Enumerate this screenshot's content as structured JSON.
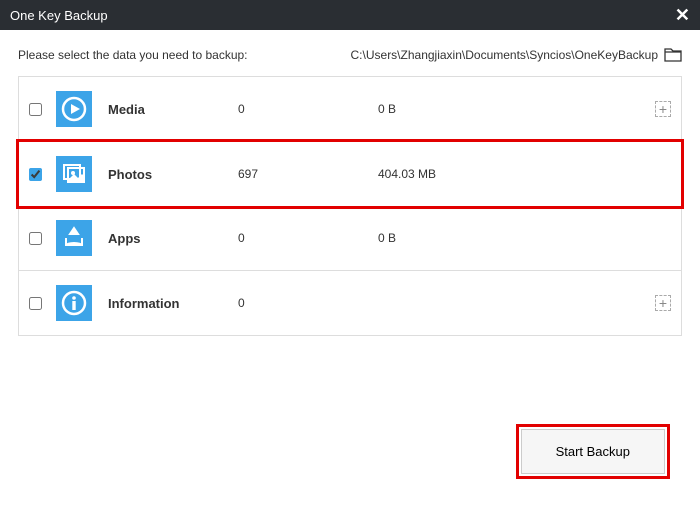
{
  "titlebar": {
    "title": "One Key Backup"
  },
  "prompt": "Please select the data you need to backup:",
  "path": "C:\\Users\\Zhangjiaxin\\Documents\\Syncios\\OneKeyBackup",
  "rows": [
    {
      "name": "Media",
      "count": "0",
      "size": "0 B",
      "checked": false,
      "icon": "media",
      "has_add": true,
      "highlighted": false
    },
    {
      "name": "Photos",
      "count": "697",
      "size": "404.03 MB",
      "checked": true,
      "icon": "photos",
      "has_add": false,
      "highlighted": true
    },
    {
      "name": "Apps",
      "count": "0",
      "size": "0 B",
      "checked": false,
      "icon": "apps",
      "has_add": false,
      "highlighted": false
    },
    {
      "name": "Information",
      "count": "0",
      "size": "",
      "checked": false,
      "icon": "info",
      "has_add": true,
      "highlighted": false
    }
  ],
  "buttons": {
    "start": "Start Backup"
  }
}
